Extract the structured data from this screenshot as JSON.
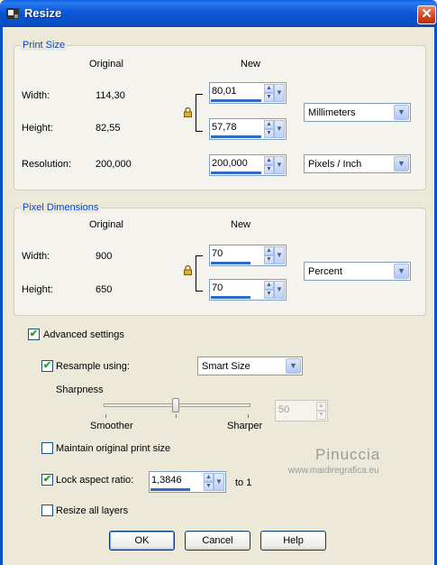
{
  "window": {
    "title": "Resize",
    "close_glyph": "✕"
  },
  "print_size": {
    "legend": "Print Size",
    "original_header": "Original",
    "new_header": "New",
    "width_label": "Width:",
    "width_original": "114,30",
    "width_new": "80,01",
    "height_label": "Height:",
    "height_original": "82,55",
    "height_new": "57,78",
    "unit": "Millimeters",
    "resolution_label": "Resolution:",
    "resolution_original": "200,000",
    "resolution_new": "200,000",
    "resolution_unit": "Pixels / Inch"
  },
  "pixel_dimensions": {
    "legend": "Pixel Dimensions",
    "original_header": "Original",
    "new_header": "New",
    "width_label": "Width:",
    "width_original": "900",
    "width_new": "70",
    "height_label": "Height:",
    "height_original": "650",
    "height_new": "70",
    "unit": "Percent"
  },
  "advanced": {
    "advanced_label": "Advanced settings",
    "advanced_checked": true,
    "resample_label": "Resample using:",
    "resample_checked": true,
    "resample_method": "Smart Size",
    "sharpness_label": "Sharpness",
    "smoother_label": "Smoother",
    "sharper_label": "Sharper",
    "sharpness_value": "50",
    "maintain_label": "Maintain original print size",
    "maintain_checked": false,
    "lock_label": "Lock aspect ratio:",
    "lock_checked": true,
    "aspect_value": "1,3846",
    "to_one_label": "to 1",
    "resize_layers_label": "Resize all layers",
    "resize_layers_checked": false
  },
  "watermark": {
    "name": "Pinuccia",
    "url": "www.maidiregrafica.eu"
  },
  "buttons": {
    "ok": "OK",
    "cancel": "Cancel",
    "help": "Help"
  },
  "colors": {
    "titlebar": "#0a5fe6",
    "legend": "#0046d5",
    "check": "#21a121"
  }
}
